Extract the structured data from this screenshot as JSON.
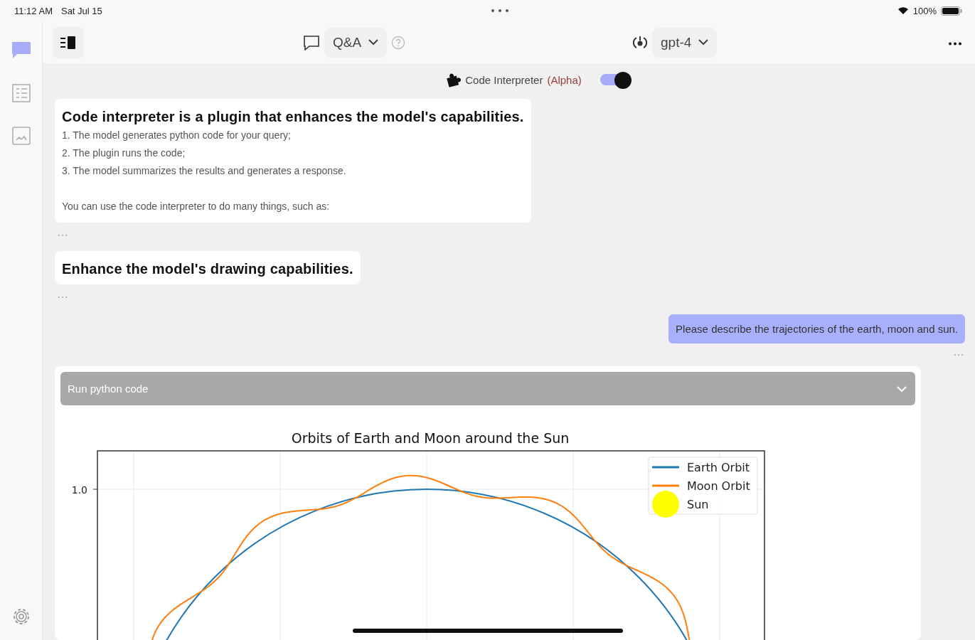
{
  "status_bar": {
    "time": "11:12 AM",
    "date": "Sat Jul 15",
    "battery": "100%"
  },
  "sidebar": {
    "items": [
      {
        "kind": "chat",
        "selected": true
      },
      {
        "kind": "list",
        "selected": false
      },
      {
        "kind": "image",
        "selected": false
      }
    ]
  },
  "toolbar": {
    "mode": "Q&A",
    "model": "gpt-4"
  },
  "plugin": {
    "name": "Code Interpreter",
    "stage": "(Alpha)",
    "on": true
  },
  "messages": [
    {
      "kind": "assistant_text",
      "heading": "Code interpreter is a plugin that enhances the model's capabilities.",
      "lines": [
        "1. The model generates python code for your query;",
        "2. The plugin runs the code;",
        "3. The model summarizes the results and generates a response."
      ],
      "note": "You can use the code interpreter to do many things, such as:"
    },
    {
      "kind": "assistant_text",
      "heading": "Enhance the model's drawing capabilities."
    },
    {
      "kind": "user_text",
      "text": "Please describe the trajectories of the earth, moon and sun."
    },
    {
      "kind": "assistant_code",
      "summary": "Run python code",
      "expanded": false,
      "figure": {
        "title": "Orbits of Earth and Moon around the Sun",
        "ytick": "1.0",
        "legend": [
          {
            "label": "Earth Orbit",
            "kind": "line",
            "color": "#1f77b4"
          },
          {
            "label": "Moon Orbit",
            "kind": "line",
            "color": "#ff7f0e"
          },
          {
            "label": "Sun",
            "kind": "dot",
            "color": "#ffff00"
          }
        ]
      }
    }
  ]
}
